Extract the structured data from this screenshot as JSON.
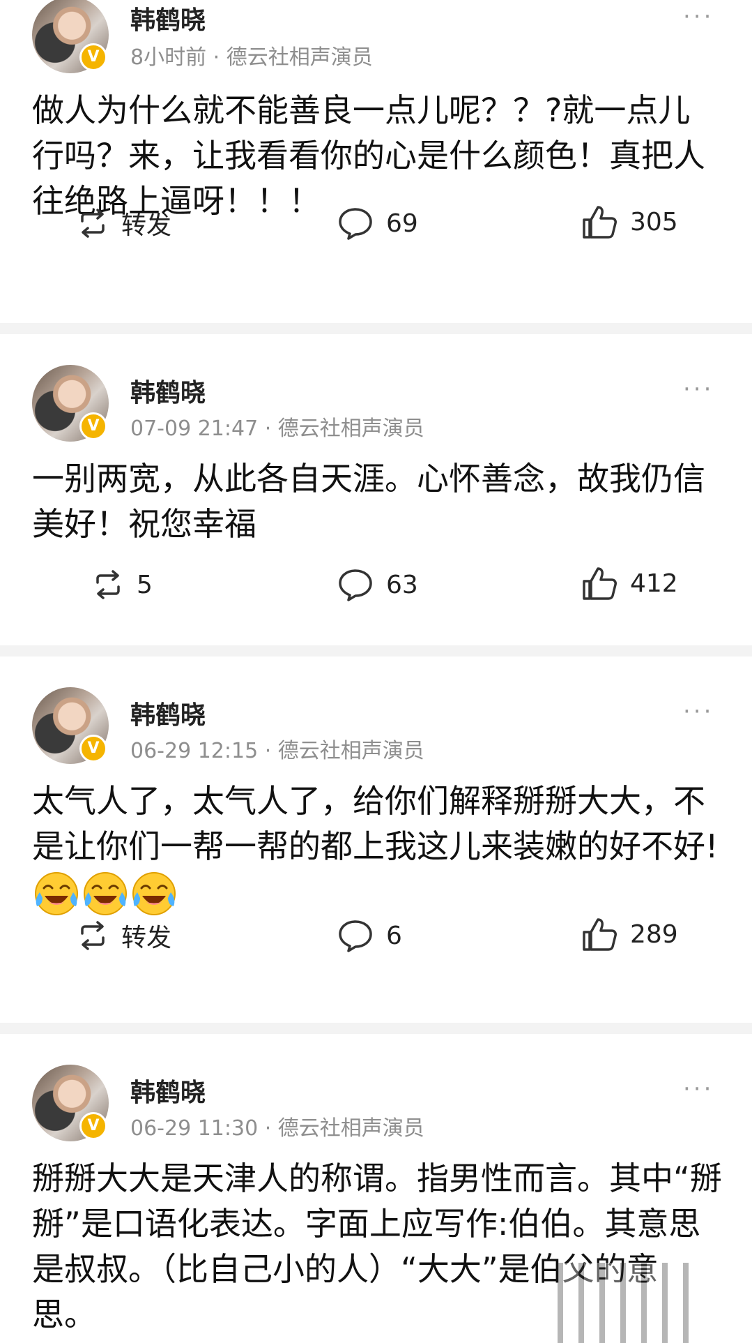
{
  "posts": [
    {
      "author": "韩鹤晓",
      "meta": "8小时前 · 德云社相声演员",
      "text": "做人为什么就不能善良一点儿呢？？?就一点儿行吗？来，让我看看你的心是什么颜色！真把人往绝路上逼呀！！！",
      "emoji_count": 0,
      "repost": "转发",
      "comments": "69",
      "likes": "305"
    },
    {
      "author": "韩鹤晓",
      "meta": "07-09 21:47 · 德云社相声演员",
      "text": "一别两宽，从此各自天涯。心怀善念，故我仍信美好！祝您幸福",
      "emoji_count": 0,
      "repost": "5",
      "comments": "63",
      "likes": "412"
    },
    {
      "author": "韩鹤晓",
      "meta": "06-29 12:15 · 德云社相声演员",
      "text": "太气人了，太气人了，给你们解释掰掰大大，不是让你们一帮一帮的都上我这儿来装嫩的好不好!",
      "emoji_count": 3,
      "emoji_name": "crying-laughing-emoji",
      "repost": "转发",
      "comments": "6",
      "likes": "289"
    },
    {
      "author": "韩鹤晓",
      "meta": "06-29 11:30 · 德云社相声演员",
      "text": "掰掰大大是天津人的称谓。指男性而言。其中“掰掰”是口语化表达。字面上应写作:伯伯。其意思是叔叔。（比自己小的人）“大大”是伯父的意思。"
    }
  ],
  "icons": {
    "repost": "repost-icon",
    "comment": "comment-icon",
    "like": "thumbs-up-icon",
    "more": "more-icon",
    "verified": "verified-badge-icon"
  },
  "colors": {
    "verified_badge": "#f5b400",
    "meta_text": "#8e8e8e",
    "separator": "#f3f3f3"
  }
}
